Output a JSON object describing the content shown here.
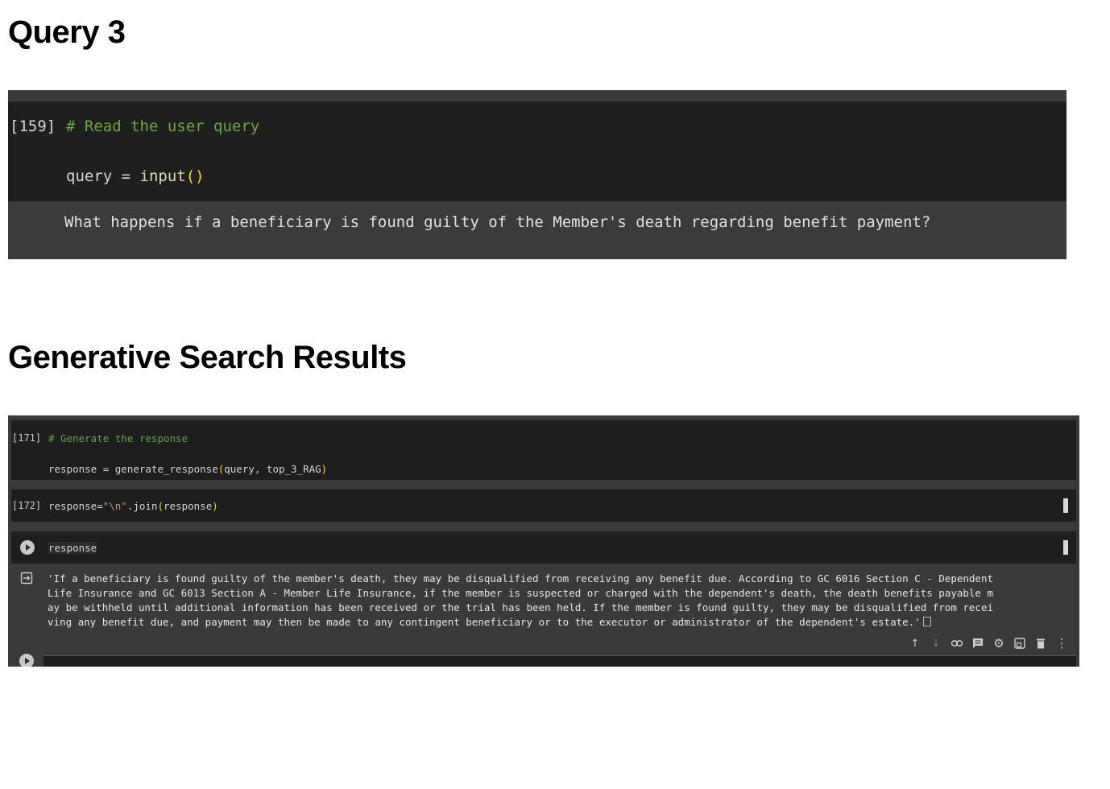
{
  "headings": {
    "query": "Query 3",
    "results": "Generative Search Results"
  },
  "query_cell": {
    "exec_count": "[159]",
    "comment": "# Read the user query",
    "code_var": "query = ",
    "code_func": "input",
    "code_open": "(",
    "code_close": ")",
    "output": "What happens if a beneficiary is found guilty of the Member's death regarding benefit payment?"
  },
  "results": {
    "cell_171": {
      "exec_count": "[171]",
      "comment": "# Generate the response",
      "code_pre": "response = generate_response",
      "code_open": "(",
      "code_args": "query, top_3_RAG",
      "code_close": ")"
    },
    "cell_172": {
      "exec_count": "[172]",
      "code_pre": "response=",
      "code_str": "\"\\n\"",
      "code_mid": ".join",
      "code_open": "(",
      "code_args": "response",
      "code_close": ")"
    },
    "cell_173": {
      "code": "response",
      "output_lines": [
        "'If a beneficiary is found guilty of the member's death, they may be disqualified from receiving any benefit due. According to GC 6016 Section C - Dependent",
        "Life Insurance and GC 6013 Section A - Member Life Insurance, if the member is suspected or charged with the dependent's death, the death benefits payable m",
        "ay be withheld until additional information has been received or the trial has been held. If the member is found guilty, they may be disqualified from recei",
        "ving any benefit due, and payment may then be made to any contingent beneficiary or to the executor or administrator of the dependent's estate.'"
      ]
    },
    "toolbar_icons": [
      "arrow-up-icon",
      "arrow-down-icon",
      "link-icon",
      "comment-icon",
      "gear-icon",
      "mirror-cell-icon",
      "trash-icon",
      "more-vert-icon"
    ]
  },
  "colors": {
    "code_bg": "#1e1e1e",
    "panel_bg": "#3a3a3a",
    "comment_green": "#6aaa3a",
    "func_yellow": "#dcdcaa",
    "paren_gold": "#ffd700",
    "string_orange": "#ce9178"
  }
}
